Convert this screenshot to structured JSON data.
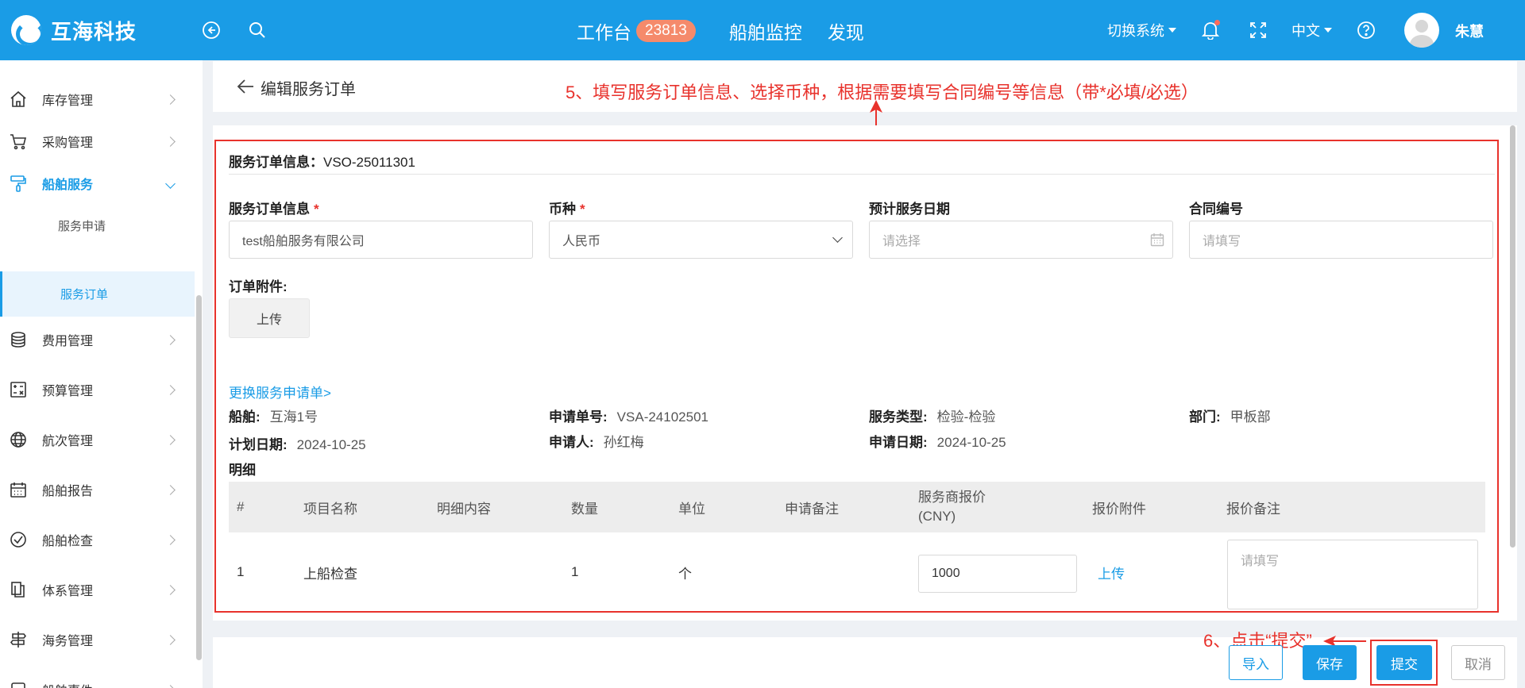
{
  "header": {
    "logo_text": "互海科技",
    "nav": {
      "workbench": "工作台",
      "workbench_badge": "23813",
      "ship_monitor": "船舶监控",
      "discover": "发现"
    },
    "switch_system": "切换系统",
    "language": "中文",
    "user_name": "朱慧"
  },
  "sidebar": {
    "items": [
      {
        "label": "库存管理",
        "icon": "house-icon"
      },
      {
        "label": "采购管理",
        "icon": "cart-icon"
      },
      {
        "label": "船舶服务",
        "icon": "paint-roller-icon",
        "open": true
      },
      {
        "label": "费用管理",
        "icon": "coins-icon"
      },
      {
        "label": "预算管理",
        "icon": "calculator-icon"
      },
      {
        "label": "航次管理",
        "icon": "globe-icon"
      },
      {
        "label": "船舶报告",
        "icon": "calendar-grid-icon"
      },
      {
        "label": "船舶检查",
        "icon": "check-circle-icon"
      },
      {
        "label": "体系管理",
        "icon": "documents-icon"
      },
      {
        "label": "海务管理",
        "icon": "signpost-icon"
      },
      {
        "label": "船舶事件",
        "icon": "event-icon"
      }
    ],
    "sub_items": [
      {
        "label": "服务申请"
      },
      {
        "label": "服务订单",
        "active": true
      }
    ]
  },
  "page": {
    "title": "编辑服务订单"
  },
  "annotations": {
    "step5": "5、填写服务订单信息、选择币种，根据需要填写合同编号等信息（带*必填/必选）",
    "step6": "6、点击“提交”"
  },
  "form": {
    "section_label": "服务订单信息：",
    "order_no": "VSO-25011301",
    "fields": {
      "order_info_label": "服务订单信息",
      "order_info_value": "test船舶服务有限公司",
      "currency_label": "币种",
      "currency_value": "人民币",
      "service_date_label": "预计服务日期",
      "service_date_placeholder": "请选择",
      "contract_label": "合同编号",
      "contract_placeholder": "请填写",
      "attachment_label": "订单附件:",
      "upload_label": "上传"
    },
    "change_link": "更换服务申请单>",
    "info": {
      "ship_label": "船舶:",
      "ship_value": "互海1号",
      "apply_no_label": "申请单号:",
      "apply_no_value": "VSA-24102501",
      "service_type_label": "服务类型:",
      "service_type_value": "检验-检验",
      "dept_label": "部门:",
      "dept_value": "甲板部",
      "plan_date_label": "计划日期:",
      "plan_date_value": "2024-10-25",
      "applicant_label": "申请人:",
      "applicant_value": "孙红梅",
      "apply_date_label": "申请日期:",
      "apply_date_value": "2024-10-25"
    },
    "detail_label": "明细"
  },
  "table": {
    "columns": [
      "#",
      "项目名称",
      "明细内容",
      "数量",
      "单位",
      "申请备注",
      "服务商报价",
      "(CNY)",
      "报价附件",
      "报价备注"
    ],
    "rows": [
      {
        "index": "1",
        "item_name": "上船检查",
        "detail": "",
        "qty": "1",
        "unit": "个",
        "remark": "",
        "quote": "1000",
        "attachment_link": "上传",
        "quote_remark_placeholder": "请填写"
      }
    ]
  },
  "actions": {
    "import": "导入",
    "save": "保存",
    "submit": "提交",
    "cancel": "取消"
  },
  "colors": {
    "primary": "#1a9ce6",
    "annotation": "#e8322c",
    "badge": "#f58a6b"
  }
}
